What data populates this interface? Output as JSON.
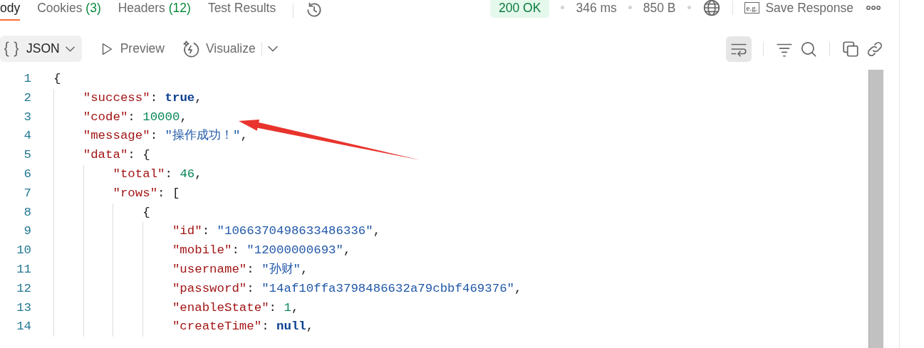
{
  "tabs": [
    {
      "label": "ody",
      "selected": true
    },
    {
      "label": "Cookies",
      "count": "(3)",
      "selected": false
    },
    {
      "label": "Headers",
      "count": "(12)",
      "selected": false
    },
    {
      "label": "Test Results",
      "selected": false
    }
  ],
  "status": {
    "code": "200 OK",
    "time": "346 ms",
    "size": "850 B"
  },
  "save_response": {
    "icon_text": "e.g.",
    "label": "Save Response"
  },
  "view_bar": {
    "format": "JSON",
    "preview": "Preview",
    "visualize": "Visualize",
    "wrap_on": true
  },
  "code_lines": [
    {
      "number": "1",
      "tokens": [
        {
          "kind": "punct",
          "text": "{"
        }
      ],
      "children": [
        {
          "number": "2",
          "tokens": [
            {
              "kind": "key",
              "text": "\"success\""
            },
            {
              "kind": "punct",
              "text": ": "
            },
            {
              "kind": "keyword",
              "text": "true"
            },
            {
              "kind": "punct",
              "text": ","
            }
          ]
        },
        {
          "number": "3",
          "tokens": [
            {
              "kind": "key",
              "text": "\"code\""
            },
            {
              "kind": "punct",
              "text": ": "
            },
            {
              "kind": "number",
              "text": "10000"
            },
            {
              "kind": "punct",
              "text": ","
            }
          ]
        },
        {
          "number": "4",
          "tokens": [
            {
              "kind": "key",
              "text": "\"message\""
            },
            {
              "kind": "punct",
              "text": ": "
            },
            {
              "kind": "string",
              "text": "\"操作成功！\""
            },
            {
              "kind": "punct",
              "text": ","
            }
          ]
        },
        {
          "number": "5",
          "tokens": [
            {
              "kind": "key",
              "text": "\"data\""
            },
            {
              "kind": "punct",
              "text": ": {"
            }
          ],
          "children": [
            {
              "number": "6",
              "tokens": [
                {
                  "kind": "key",
                  "text": "\"total\""
                },
                {
                  "kind": "punct",
                  "text": ": "
                },
                {
                  "kind": "number",
                  "text": "46"
                },
                {
                  "kind": "punct",
                  "text": ","
                }
              ]
            },
            {
              "number": "7",
              "tokens": [
                {
                  "kind": "key",
                  "text": "\"rows\""
                },
                {
                  "kind": "punct",
                  "text": ": ["
                }
              ],
              "children": [
                {
                  "number": "8",
                  "tokens": [
                    {
                      "kind": "punct",
                      "text": "{"
                    }
                  ],
                  "children": [
                    {
                      "number": "9",
                      "tokens": [
                        {
                          "kind": "key",
                          "text": "\"id\""
                        },
                        {
                          "kind": "punct",
                          "text": ": "
                        },
                        {
                          "kind": "string",
                          "text": "\"1066370498633486336\""
                        },
                        {
                          "kind": "punct",
                          "text": ","
                        }
                      ]
                    },
                    {
                      "number": "10",
                      "tokens": [
                        {
                          "kind": "key",
                          "text": "\"mobile\""
                        },
                        {
                          "kind": "punct",
                          "text": ": "
                        },
                        {
                          "kind": "string",
                          "text": "\"12000000693\""
                        },
                        {
                          "kind": "punct",
                          "text": ","
                        }
                      ]
                    },
                    {
                      "number": "11",
                      "tokens": [
                        {
                          "kind": "key",
                          "text": "\"username\""
                        },
                        {
                          "kind": "punct",
                          "text": ": "
                        },
                        {
                          "kind": "string",
                          "text": "\"孙财\""
                        },
                        {
                          "kind": "punct",
                          "text": ","
                        }
                      ]
                    },
                    {
                      "number": "12",
                      "tokens": [
                        {
                          "kind": "key",
                          "text": "\"password\""
                        },
                        {
                          "kind": "punct",
                          "text": ": "
                        },
                        {
                          "kind": "string",
                          "text": "\"14af10ffa3798486632a79cbbf469376\""
                        },
                        {
                          "kind": "punct",
                          "text": ","
                        }
                      ]
                    },
                    {
                      "number": "13",
                      "tokens": [
                        {
                          "kind": "key",
                          "text": "\"enableState\""
                        },
                        {
                          "kind": "punct",
                          "text": ": "
                        },
                        {
                          "kind": "number",
                          "text": "1"
                        },
                        {
                          "kind": "punct",
                          "text": ","
                        }
                      ]
                    },
                    {
                      "number": "14",
                      "tokens": [
                        {
                          "kind": "key",
                          "text": "\"createTime\""
                        },
                        {
                          "kind": "punct",
                          "text": ": "
                        },
                        {
                          "kind": "keyword",
                          "text": "null"
                        },
                        {
                          "kind": "punct",
                          "text": ","
                        }
                      ]
                    }
                  ]
                }
              ]
            }
          ]
        }
      ]
    }
  ]
}
